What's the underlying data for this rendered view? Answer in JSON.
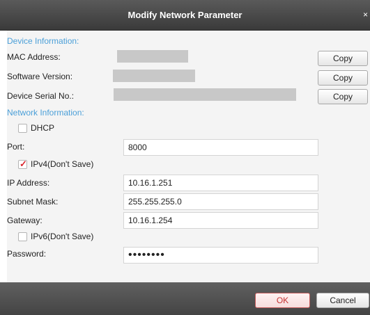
{
  "dialog": {
    "title": "Modify Network Parameter",
    "close_glyph": "×"
  },
  "device_info": {
    "header": "Device Information:",
    "mac_label": "MAC Address:",
    "software_label": "Software Version:",
    "serial_label": "Device Serial No.:",
    "copy_label": "Copy"
  },
  "network_info": {
    "header": "Network Information:",
    "dhcp": {
      "label": "DHCP",
      "checked": false
    },
    "port": {
      "label": "Port:",
      "value": "8000"
    },
    "ipv4": {
      "label": "IPv4(Don't Save)",
      "checked": true,
      "check_glyph": "✓"
    },
    "ip_address": {
      "label": "IP Address:",
      "value": "10.16.1.251"
    },
    "subnet_mask": {
      "label": "Subnet Mask:",
      "value": "255.255.255.0"
    },
    "gateway": {
      "label": "Gateway:",
      "value": "10.16.1.254"
    },
    "ipv6": {
      "label": "IPv6(Don't Save)",
      "checked": false
    },
    "password": {
      "label": "Password:",
      "value": "••••••••"
    }
  },
  "footer": {
    "ok_label": "OK",
    "cancel_label": "Cancel"
  },
  "colors": {
    "accent": "#4a9fd8",
    "ok_text": "#c53030",
    "check": "#d9272e"
  }
}
